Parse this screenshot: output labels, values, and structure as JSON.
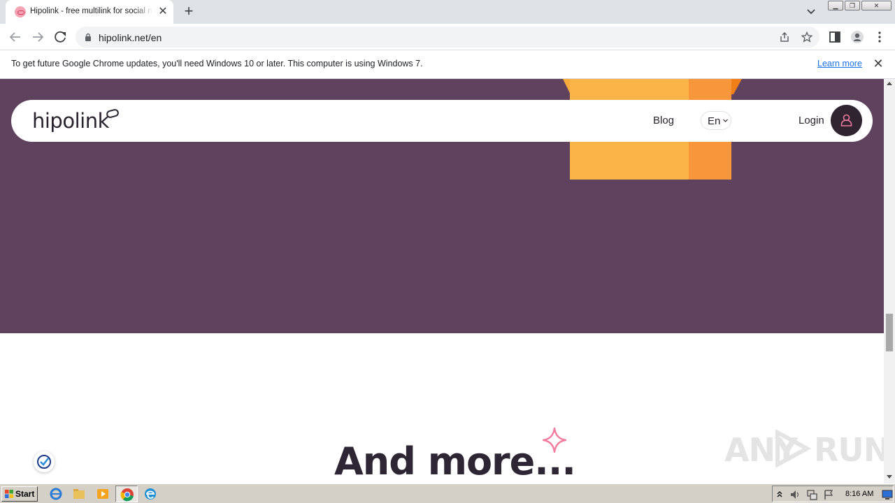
{
  "browser": {
    "tab_title": "Hipolink - free multilink for social networks",
    "tab_close_glyph": "✕",
    "new_tab_glyph": "+",
    "url": "hipolink.net/en",
    "window_controls": [
      "minimize",
      "restore",
      "close"
    ]
  },
  "infobar": {
    "message": "To get future Google Chrome updates, you'll need Windows 10 or later. This computer is using Windows 7.",
    "link": "Learn more",
    "close_glyph": "✕"
  },
  "site": {
    "logo": "hipolink",
    "nav": {
      "blog": "Blog",
      "language": "En",
      "login": "Login"
    },
    "section_title": "And more...",
    "colors": {
      "hero_bg": "#5e425e",
      "box_front": "#fab447",
      "box_side": "#f7963a",
      "accent_pink": "#f47b9e"
    }
  },
  "watermark": {
    "text_left": "ANY",
    "text_right": "RUN"
  },
  "taskbar": {
    "start_label": "Start",
    "clock": "8:16 AM",
    "pinned": [
      "internet-explorer",
      "file-explorer",
      "media-player",
      "chrome",
      "edge"
    ]
  }
}
